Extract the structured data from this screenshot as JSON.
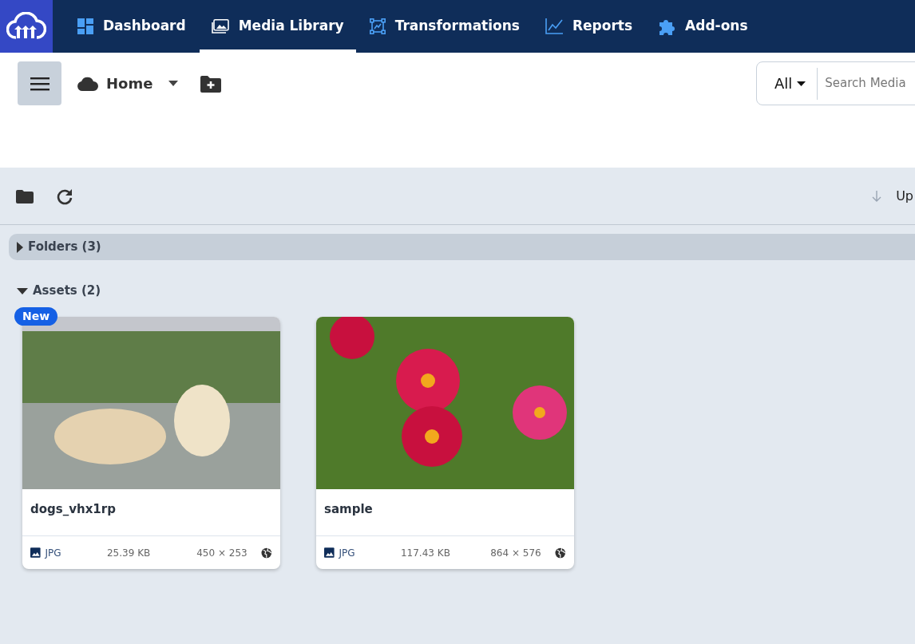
{
  "nav": {
    "items": [
      {
        "label": "Dashboard",
        "selected": false
      },
      {
        "label": "Media Library",
        "selected": true
      },
      {
        "label": "Transformations",
        "selected": false
      },
      {
        "label": "Reports",
        "selected": false
      },
      {
        "label": "Add-ons",
        "selected": false
      }
    ]
  },
  "toolbar": {
    "location": "Home",
    "filter": "All",
    "search_placeholder": "Search Media"
  },
  "actions": {
    "sort_label": "Up"
  },
  "sections": [
    {
      "label": "Folders (3)",
      "expanded": false
    },
    {
      "label": "Assets (2)",
      "expanded": true
    }
  ],
  "assets": [
    {
      "name": "dogs_vhx1rp",
      "badge": "New",
      "format": "JPG",
      "size": "25.39 KB",
      "dimensions": "450 × 253"
    },
    {
      "name": "sample",
      "format": "JPG",
      "size": "117.43 KB",
      "dimensions": "864 × 576"
    }
  ]
}
